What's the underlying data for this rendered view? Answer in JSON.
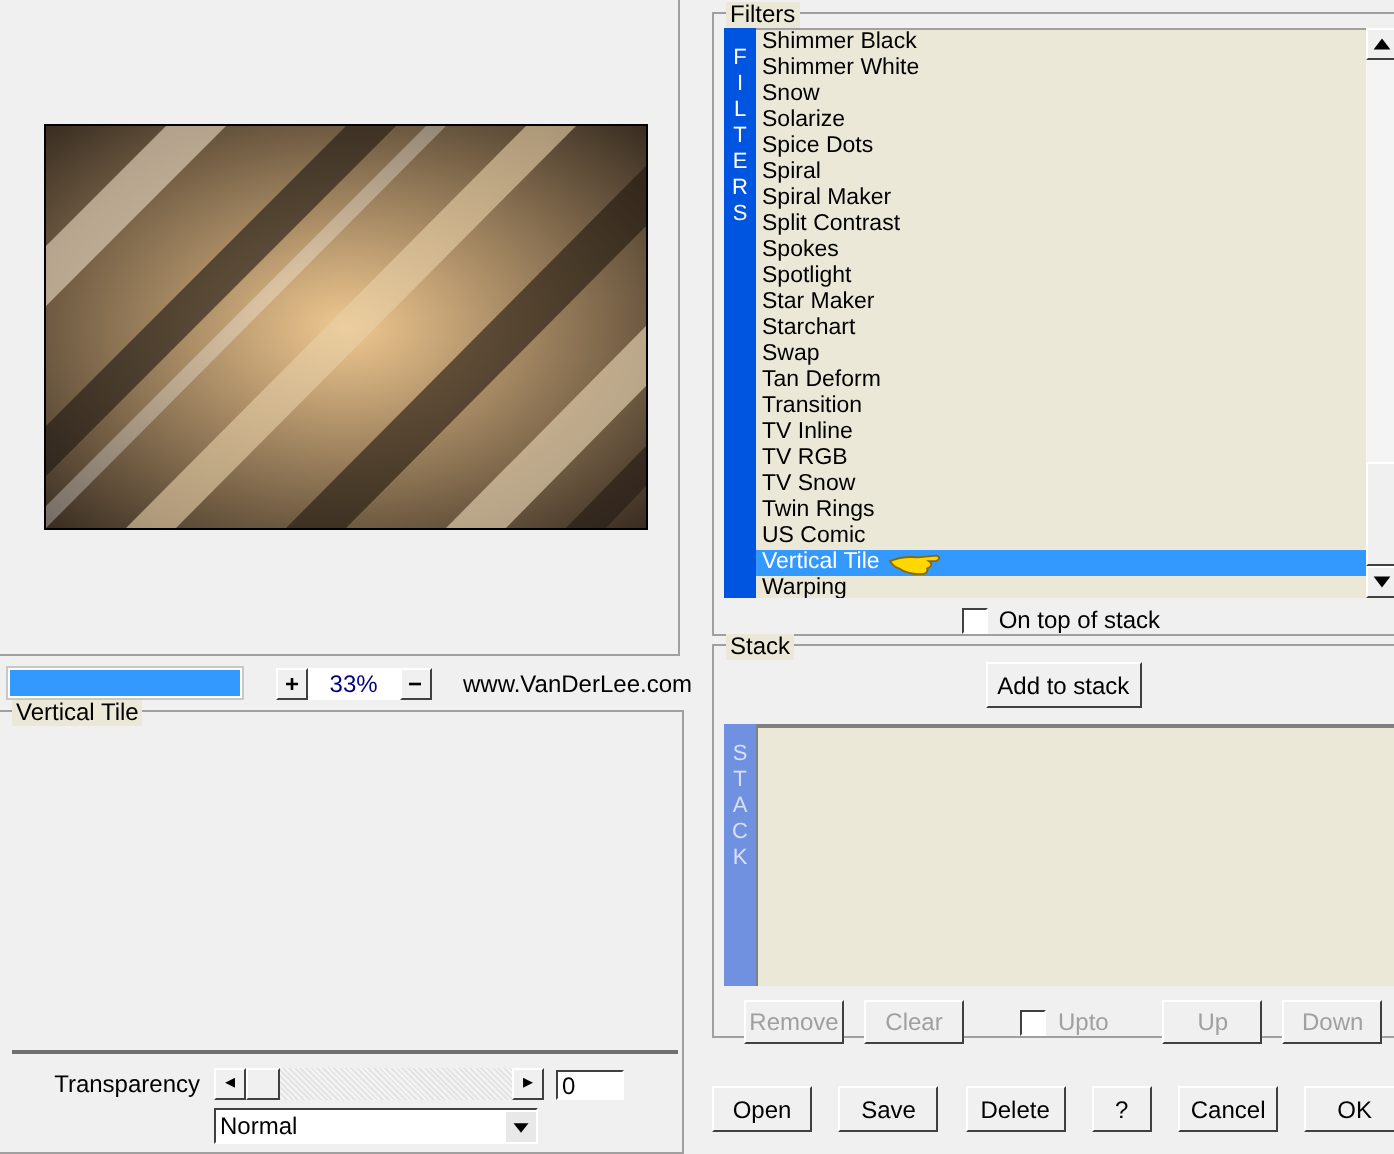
{
  "zoom": {
    "level": 1,
    "plus": "+",
    "value": "33%",
    "minus": "−",
    "website": "www.VanDerLee.com"
  },
  "settings": {
    "title": "Vertical Tile",
    "transparency_label": "Transparency",
    "transparency": {
      "level": 0,
      "left": "◂",
      "right": "▸",
      "value": "0"
    },
    "blend_mode": "Normal"
  },
  "filters": {
    "title": "Filters",
    "side_label": "FILTERS",
    "items": [
      {
        "label": "Shimmer Black",
        "selected": false
      },
      {
        "label": "Shimmer White",
        "selected": false
      },
      {
        "label": "Snow",
        "selected": false
      },
      {
        "label": "Solarize",
        "selected": false
      },
      {
        "label": "Spice Dots",
        "selected": false
      },
      {
        "label": "Spiral",
        "selected": false
      },
      {
        "label": "Spiral Maker",
        "selected": false
      },
      {
        "label": "Split Contrast",
        "selected": false
      },
      {
        "label": "Spokes",
        "selected": false
      },
      {
        "label": "Spotlight",
        "selected": false
      },
      {
        "label": "Star Maker",
        "selected": false
      },
      {
        "label": "Starchart",
        "selected": false
      },
      {
        "label": "Swap",
        "selected": false
      },
      {
        "label": "Tan Deform",
        "selected": false
      },
      {
        "label": "Transition",
        "selected": false
      },
      {
        "label": "TV Inline",
        "selected": false
      },
      {
        "label": "TV RGB",
        "selected": false
      },
      {
        "label": "TV Snow",
        "selected": false
      },
      {
        "label": "Twin Rings",
        "selected": false
      },
      {
        "label": "US Comic",
        "selected": false
      },
      {
        "label": "Vertical Tile",
        "selected": true
      },
      {
        "label": "Warping",
        "selected": false
      }
    ],
    "on_top": {
      "label": "On top of stack",
      "checked": false
    }
  },
  "stack": {
    "title": "Stack",
    "add": "Add to stack",
    "side_label": "STACK",
    "buttons": [
      {
        "label": "Remove",
        "disabled": true
      },
      {
        "label": "Clear",
        "disabled": true
      }
    ],
    "upto": {
      "label": "Upto",
      "checked": false,
      "disabled": true
    },
    "buttons2": [
      {
        "label": "Up",
        "disabled": true
      },
      {
        "label": "Down",
        "disabled": true
      }
    ]
  },
  "footer": [
    "Open",
    "Save",
    "Delete",
    "?",
    "Cancel",
    "OK"
  ]
}
